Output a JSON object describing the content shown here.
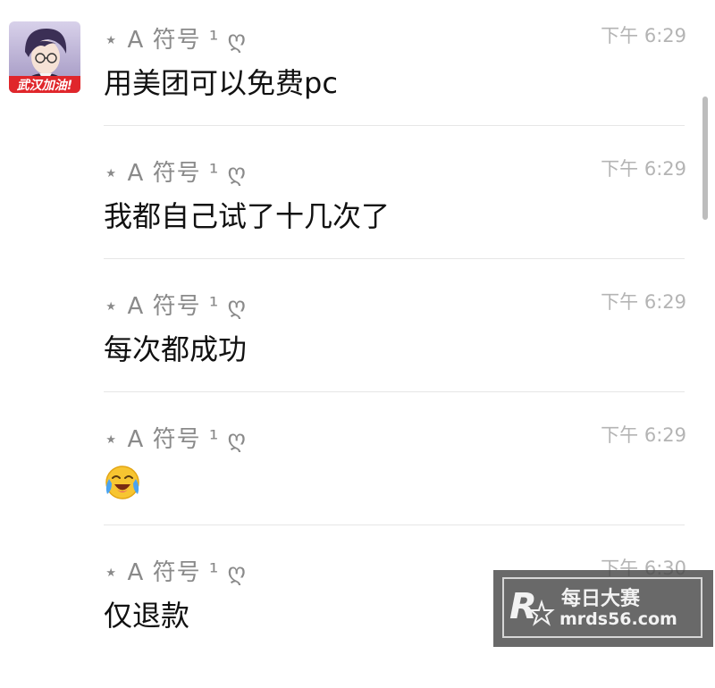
{
  "avatar": {
    "badge_text": "武汉加油!"
  },
  "messages": [
    {
      "sender": "⋆  A 符号 ¹ ღ",
      "time": "下午 6:29",
      "text": "用美团可以免费pc"
    },
    {
      "sender": "⋆  A 符号 ¹ ღ",
      "time": "下午 6:29",
      "text": "我都自己试了十几次了"
    },
    {
      "sender": "⋆  A 符号 ¹ ღ",
      "time": "下午 6:29",
      "text": "每次都成功"
    },
    {
      "sender": "⋆  A 符号 ¹ ღ",
      "time": "下午 6:29",
      "emoji": "face-with-tears-of-joy"
    },
    {
      "sender": "⋆  A 符号 ¹ ღ",
      "time": "下午 6:30",
      "text": "仅退款"
    }
  ],
  "watermark": {
    "text_cn": "每日大赛",
    "url": "mrds56.com"
  }
}
